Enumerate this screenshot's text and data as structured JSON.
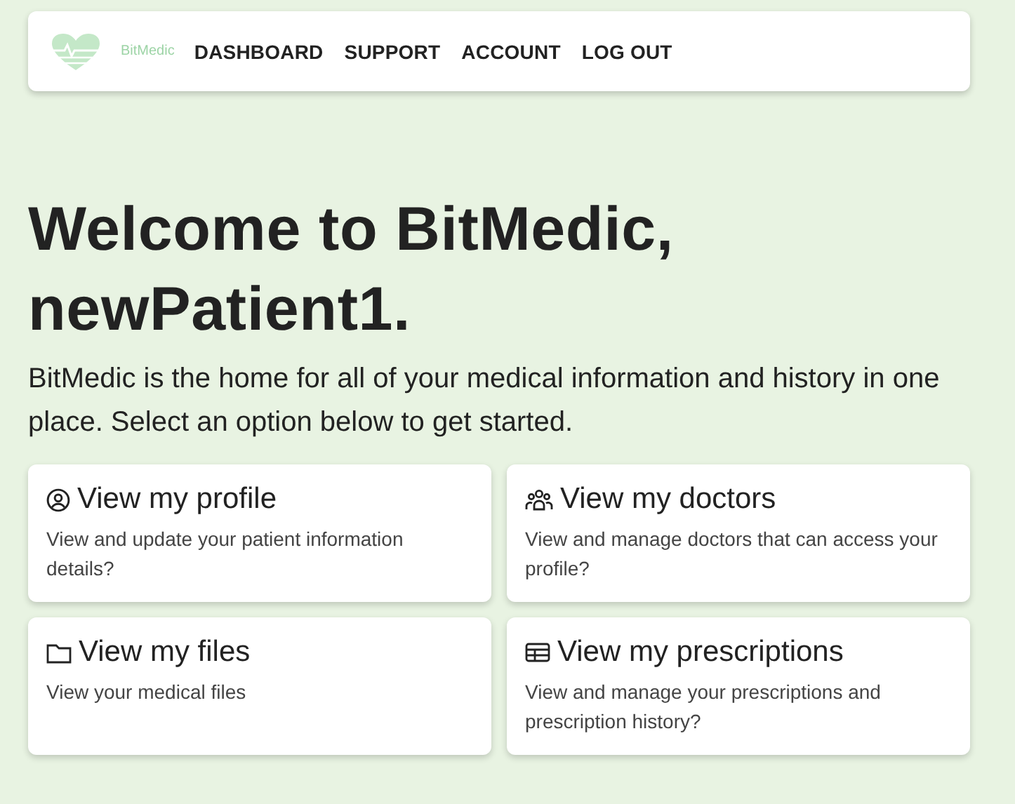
{
  "navbar": {
    "brand": "BitMedic",
    "links": [
      "DASHBOARD",
      "SUPPORT",
      "ACCOUNT",
      "LOG OUT"
    ]
  },
  "heading": "Welcome to BitMedic, newPatient1.",
  "intro": "BitMedic is the home for all of your medical information and history in one place. Select an option below to get started.",
  "cards": [
    {
      "kind": "profile",
      "title": "View my profile",
      "description": "View and update your patient information details?"
    },
    {
      "kind": "doctors",
      "title": "View my doctors",
      "description": "View and manage doctors that can access your profile?"
    },
    {
      "kind": "files",
      "title": "View my files",
      "description": "View your medical files"
    },
    {
      "kind": "prescriptions",
      "title": "View my prescriptions",
      "description": "View and manage your prescriptions and prescription history?"
    }
  ]
}
